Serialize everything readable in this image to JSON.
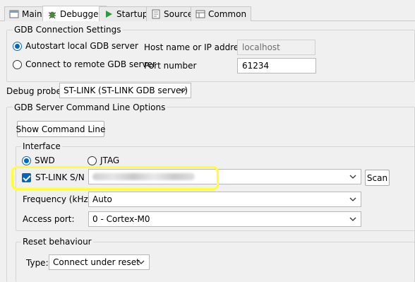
{
  "tabs": [
    {
      "label": "Main",
      "icon": "main-icon"
    },
    {
      "label": "Debugger",
      "icon": "debugger-bug-icon",
      "active": true
    },
    {
      "label": "Startup",
      "icon": "startup-play-icon"
    },
    {
      "label": "Source",
      "icon": "source-icon"
    },
    {
      "label": "Common",
      "icon": "common-icon"
    }
  ],
  "gdb_connection": {
    "title": "GDB Connection Settings",
    "autostart_label": "Autostart local GDB server",
    "remote_label": "Connect to remote GDB server",
    "host_label": "Host name or IP address",
    "host_value": "localhost",
    "port_label": "Port number",
    "port_value": "61234"
  },
  "debug_probe": {
    "label": "Debug probe",
    "value": "ST-LINK (ST-LINK GDB server)"
  },
  "gdb_server_options": {
    "title": "GDB Server Command Line Options",
    "show_cmd_button": "Show Command Line"
  },
  "interface": {
    "title": "Interface",
    "swd_label": "SWD",
    "jtag_label": "JTAG",
    "stlink_sn_label": "ST-LINK S/N",
    "scan_button": "Scan",
    "frequency_label": "Frequency (kHz):",
    "frequency_value": "Auto",
    "access_port_label": "Access port:",
    "access_port_value": "0 - Cortex-M0"
  },
  "reset": {
    "title": "Reset behaviour",
    "type_label": "Type:",
    "type_value": "Connect under reset"
  },
  "colors": {
    "accent": "#0067c0",
    "highlight": "#ffff33"
  }
}
